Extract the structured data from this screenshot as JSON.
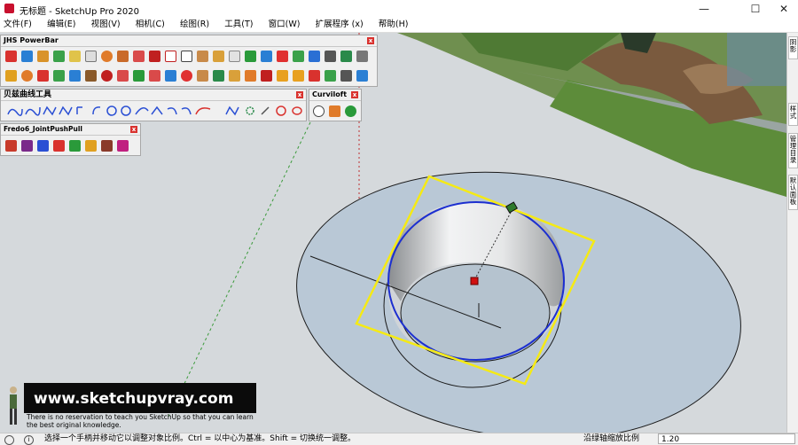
{
  "window": {
    "title": "无标题 - SketchUp Pro 2020",
    "minimize_glyph": "—",
    "maximize_glyph": "☐",
    "close_glyph": "✕"
  },
  "menu": {
    "items": [
      "文件(F)",
      "编辑(E)",
      "视图(V)",
      "相机(C)",
      "绘图(R)",
      "工具(T)",
      "窗口(W)",
      "扩展程序 (x)",
      "帮助(H)"
    ]
  },
  "toolbars": {
    "powerbar_title": "JHS PowerBar",
    "bezier_title": "贝兹曲线工具",
    "curviloft_title": "Curviloft",
    "jointpushpull_title": "Fredo6_JointPushPull",
    "close_glyph": "x"
  },
  "right_tray": {
    "tabs": [
      "阴影",
      "样式",
      "管理目录",
      "默认面板"
    ]
  },
  "watermark": {
    "url": "www.sketchupvray.com",
    "tagline_1": "There is no reservation to teach you SketchUp so that you can learn",
    "tagline_2": "the best original knowledge."
  },
  "statusbar": {
    "message": "选择一个手柄并移动它以调整对象比例。Ctrl = 以中心为基准。Shift = 切换统一调整。",
    "vcb_label": "沿绿轴缩放比例",
    "vcb_value": "1.20"
  },
  "colors": {
    "selection_box": "#f5ea14",
    "selected_edge": "#1c2fd0",
    "viewport_bg": "#d5d9dc",
    "grass": "#5d8c3a",
    "disc_fill": "#b9c8d6"
  }
}
